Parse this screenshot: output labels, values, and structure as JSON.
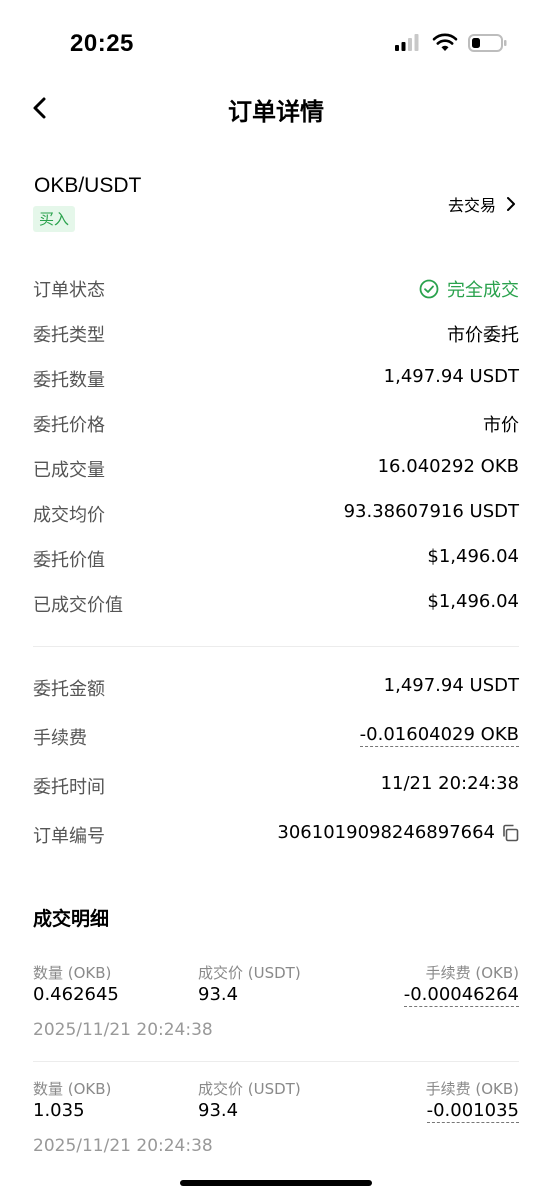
{
  "status_bar": {
    "time": "20:25"
  },
  "header": {
    "title": "订单详情"
  },
  "pair": {
    "name": "OKB/USDT",
    "side": "买入",
    "trade_link": "去交易"
  },
  "details": [
    {
      "label": "订单状态",
      "value": "完全成交"
    },
    {
      "label": "委托类型",
      "value": "市价委托"
    },
    {
      "label": "委托数量",
      "value": "1,497.94 USDT"
    },
    {
      "label": "委托价格",
      "value": "市价"
    },
    {
      "label": "已成交量",
      "value": "16.040292 OKB"
    },
    {
      "label": "成交均价",
      "value": "93.38607916 USDT"
    },
    {
      "label": "委托价值",
      "value": "$1,496.04"
    },
    {
      "label": "已成交价值",
      "value": "$1,496.04"
    }
  ],
  "details2": [
    {
      "label": "委托金额",
      "value": "1,497.94 USDT"
    },
    {
      "label": "手续费",
      "value": "-0.01604029 OKB"
    },
    {
      "label": "委托时间",
      "value": "11/21 20:24:38"
    },
    {
      "label": "订单编号",
      "value": "3061019098246897664"
    }
  ],
  "fills_section": {
    "title": "成交明细",
    "col_qty": "数量 (OKB)",
    "col_price": "成交价 (USDT)",
    "col_fee": "手续费 (OKB)",
    "items": [
      {
        "qty": "0.462645",
        "price": "93.4",
        "fee": "-0.00046264",
        "time": "2025/11/21 20:24:38"
      },
      {
        "qty": "1.035",
        "price": "93.4",
        "fee": "-0.001035",
        "time": "2025/11/21 20:24:38"
      }
    ]
  },
  "colors": {
    "accent_green": "#2aa24d",
    "badge_bg": "#e5f7ea"
  },
  "icons": [
    "back-arrow-icon",
    "chevron-right-icon",
    "check-circle-icon",
    "copy-icon",
    "signal-icon",
    "wifi-icon",
    "battery-icon"
  ]
}
